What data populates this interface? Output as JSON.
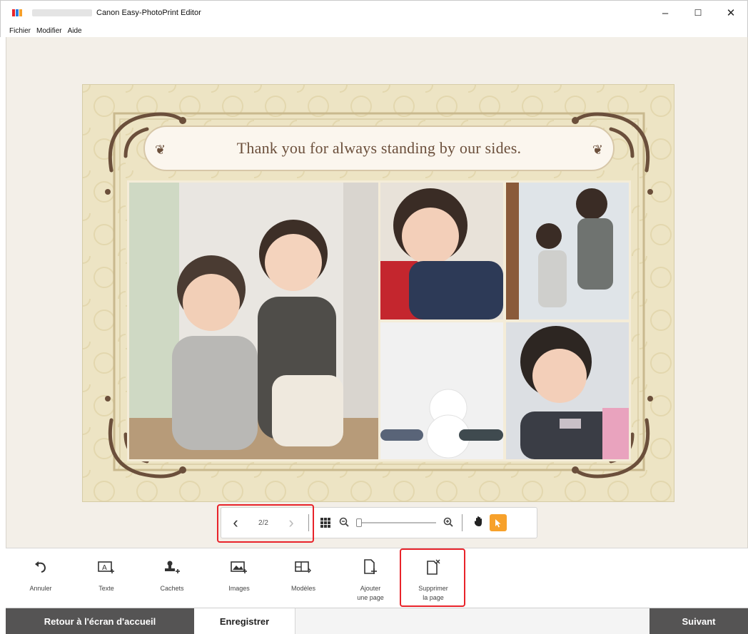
{
  "window": {
    "title": "Canon Easy-PhotoPrint Editor",
    "minimize": "–",
    "maximize": "☐",
    "close": "✕"
  },
  "menu": [
    "Fichier",
    "Modifier",
    "Aide"
  ],
  "card": {
    "message": "Thank you for always standing by our sides.",
    "ornament": "❦",
    "background_color": "#ede4c4",
    "frame_color": "#6b4f3b"
  },
  "nav": {
    "prev": "‹",
    "page": "2/2",
    "next": "›",
    "zoom_level_percent": 0
  },
  "tools": [
    {
      "icon": "undo-icon",
      "label": "Annuler"
    },
    {
      "icon": "text-icon",
      "label": "Texte"
    },
    {
      "icon": "stamp-icon",
      "label": "Cachets"
    },
    {
      "icon": "images-icon",
      "label": "Images"
    },
    {
      "icon": "templates-icon",
      "label": "Modèles"
    },
    {
      "icon": "add-page-icon",
      "label": "Ajouter\nune page"
    },
    {
      "icon": "delete-page-icon",
      "label": "Supprimer\nla page"
    }
  ],
  "bottom": {
    "home": "Retour à l'écran d'accueil",
    "save": "Enregistrer",
    "next": "Suivant"
  },
  "colors": {
    "accent": "#f7a12b",
    "highlight": "#e8232a",
    "dark_button": "#555454"
  }
}
